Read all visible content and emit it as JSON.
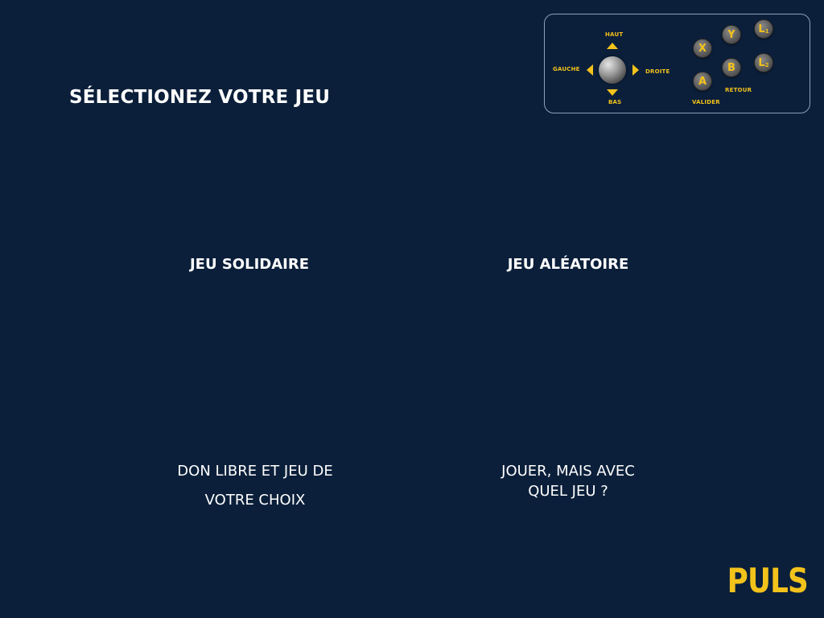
{
  "header": {
    "title": "SÉLECTIONEZ VOTRE JEU"
  },
  "controls": {
    "up_label": "HAUT",
    "down_label": "BAS",
    "left_label": "GAUCHE",
    "right_label": "DROITE",
    "button_x": "X",
    "button_y": "Y",
    "button_a": "A",
    "button_b": "B",
    "button_l1": "L",
    "button_l1_sub": "1",
    "button_l2": "L",
    "button_l2_sub": "2",
    "validate_label": "VALIDER",
    "back_label": "RETOUR",
    "accent_color": "#f3c21b"
  },
  "options": {
    "solidaire": {
      "title": "JEU SOLIDAIRE",
      "desc_line1": "DON LIBRE ET JEU DE",
      "desc_line2": "VOTRE CHOIX"
    },
    "aleatoire": {
      "title": "JEU ALÉATOIRE",
      "desc_line1": "JOUER, MAIS AVEC",
      "desc_line2": "QUEL JEU ?"
    }
  },
  "brand": {
    "name": "PULS"
  },
  "colors": {
    "background": "#0b1f3a",
    "accent": "#f3c21b",
    "text": "#ffffff"
  }
}
